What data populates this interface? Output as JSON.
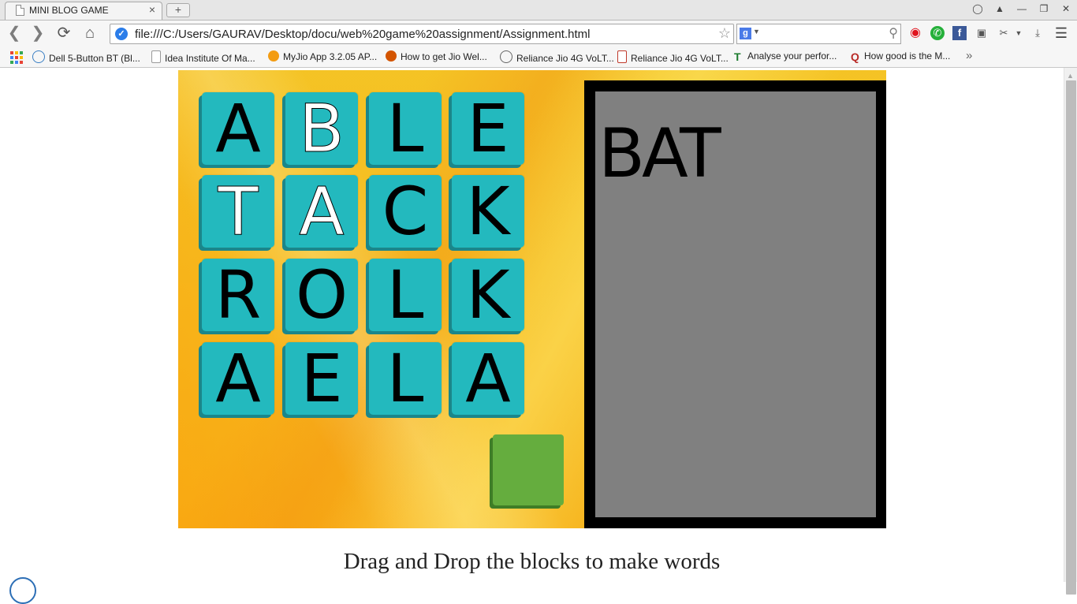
{
  "browser": {
    "tab_title": "MINI BLOG GAME",
    "tab_close": "×",
    "new_tab": "+",
    "url": "file:///C:/Users/GAURAV/Desktop/docu/web%20game%20assignment/Assignment.html",
    "search_engine": "g",
    "window_controls": [
      "minimize",
      "restore",
      "close"
    ],
    "bookmarks": [
      {
        "label": "Dell 5-Button BT (Bl...",
        "icon": "dell-icon"
      },
      {
        "label": "Idea Institute Of Ma...",
        "icon": "page-icon"
      },
      {
        "label": "MyJio App 3.2.05 AP...",
        "icon": "info-icon"
      },
      {
        "label": "How to get Jio Wel...",
        "icon": "fox-icon"
      },
      {
        "label": "Reliance Jio 4G VoLT...",
        "icon": "feather-icon"
      },
      {
        "label": "Reliance Jio 4G VoLT...",
        "icon": "doc-icon"
      },
      {
        "label": "Analyse your perfor...",
        "icon": "t-icon"
      },
      {
        "label": "How good is the M...",
        "icon": "quora-icon"
      }
    ],
    "more_bookmarks": "»",
    "colors": {
      "chrome_bg": "#f6f6f6",
      "tabstrip_bg": "#e6e6e6"
    }
  },
  "game": {
    "grid": [
      [
        {
          "letter": "A",
          "color": "black"
        },
        {
          "letter": "B",
          "color": "white"
        },
        {
          "letter": "L",
          "color": "black"
        },
        {
          "letter": "E",
          "color": "black"
        }
      ],
      [
        {
          "letter": "T",
          "color": "white"
        },
        {
          "letter": "A",
          "color": "white"
        },
        {
          "letter": "C",
          "color": "black"
        },
        {
          "letter": "K",
          "color": "black"
        }
      ],
      [
        {
          "letter": "R",
          "color": "black"
        },
        {
          "letter": "O",
          "color": "black"
        },
        {
          "letter": "L",
          "color": "black"
        },
        {
          "letter": "K",
          "color": "black"
        }
      ],
      [
        {
          "letter": "A",
          "color": "black"
        },
        {
          "letter": "E",
          "color": "black"
        },
        {
          "letter": "L",
          "color": "black"
        },
        {
          "letter": "A",
          "color": "black"
        }
      ]
    ],
    "current_word": "BAT",
    "colors": {
      "tile": "#23b9be",
      "go_block": "#65ad3e",
      "word_panel": "#808080"
    }
  },
  "instructions": "Drag and Drop the blocks to make words"
}
